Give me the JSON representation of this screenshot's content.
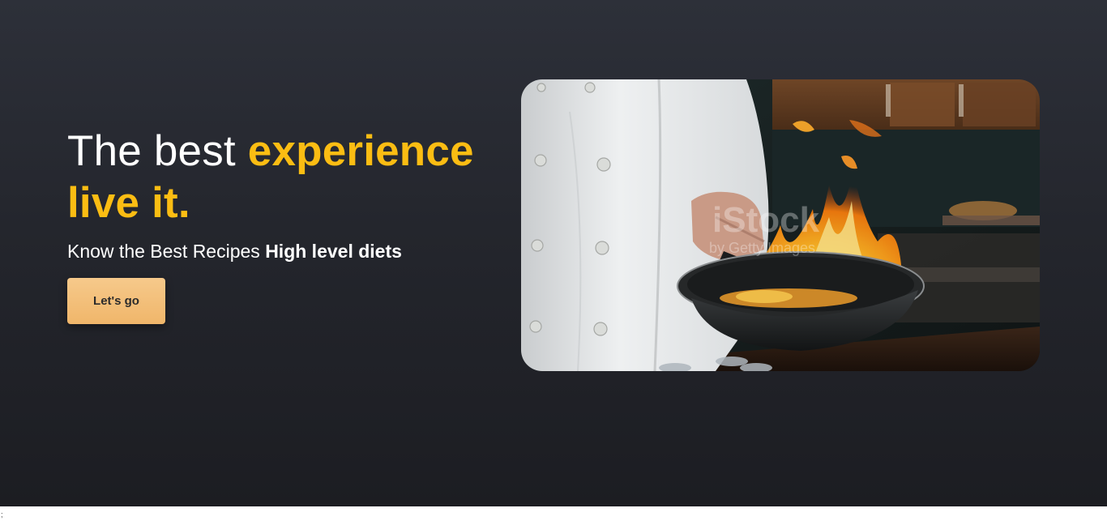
{
  "hero": {
    "headline_plain": "The best ",
    "headline_accent_1": "experience",
    "headline_accent_2": "live it.",
    "subline_plain": "Know the Best Recipes ",
    "subline_bold": "High level diets",
    "cta_label": "Let's go"
  },
  "photo": {
    "watermark_brand": "iStock",
    "watermark_credit": "by Getty Images"
  },
  "footer_artifact": ";",
  "colors": {
    "background_top": "#2d3039",
    "background_bottom": "#1c1d22",
    "accent": "#fbbd13",
    "button": "#f3c07a",
    "text": "#ffffff"
  }
}
